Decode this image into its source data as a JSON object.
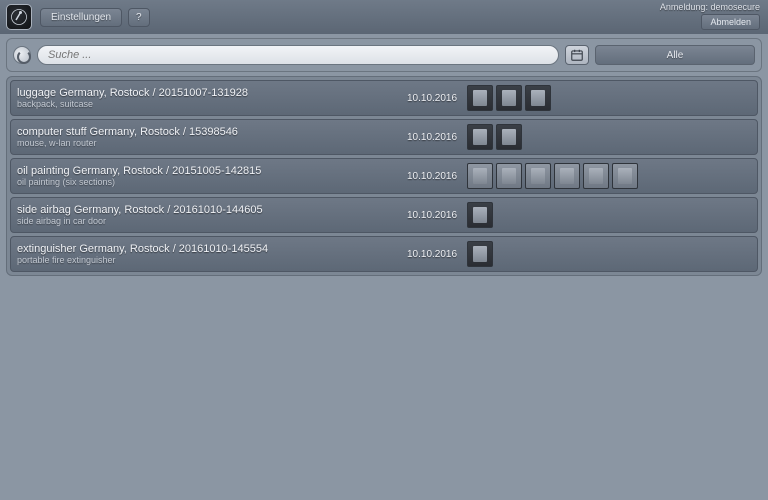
{
  "header": {
    "settings_label": "Einstellungen",
    "help_label": "?",
    "login_prefix": "Anmeldung:",
    "login_user": "demosecure",
    "logout_label": "Abmelden"
  },
  "search": {
    "placeholder": "Suche ...",
    "filter_label": "Alle"
  },
  "rows": [
    {
      "title": "luggage Germany, Rostock / 20151007-131928",
      "subtitle": "backpack, suitcase",
      "date": "10.10.2016",
      "thumbs": [
        {
          "style": "dark"
        },
        {
          "style": "dark"
        },
        {
          "style": "dark"
        }
      ]
    },
    {
      "title": "computer stuff Germany, Rostock / 15398546",
      "subtitle": "mouse, w-lan router",
      "date": "10.10.2016",
      "thumbs": [
        {
          "style": "dark"
        },
        {
          "style": "dark"
        }
      ]
    },
    {
      "title": "oil painting Germany, Rostock / 20151005-142815",
      "subtitle": "oil painting (six sections)",
      "date": "10.10.2016",
      "thumbs": [
        {
          "style": "light"
        },
        {
          "style": "light"
        },
        {
          "style": "light"
        },
        {
          "style": "light"
        },
        {
          "style": "light"
        },
        {
          "style": "light"
        }
      ]
    },
    {
      "title": "side airbag Germany, Rostock / 20161010-144605",
      "subtitle": "side airbag in car door",
      "date": "10.10.2016",
      "thumbs": [
        {
          "style": "dark"
        }
      ]
    },
    {
      "title": "extinguisher Germany, Rostock / 20161010-145554",
      "subtitle": "portable fire extinguisher",
      "date": "10.10.2016",
      "thumbs": [
        {
          "style": "dark"
        }
      ]
    }
  ]
}
